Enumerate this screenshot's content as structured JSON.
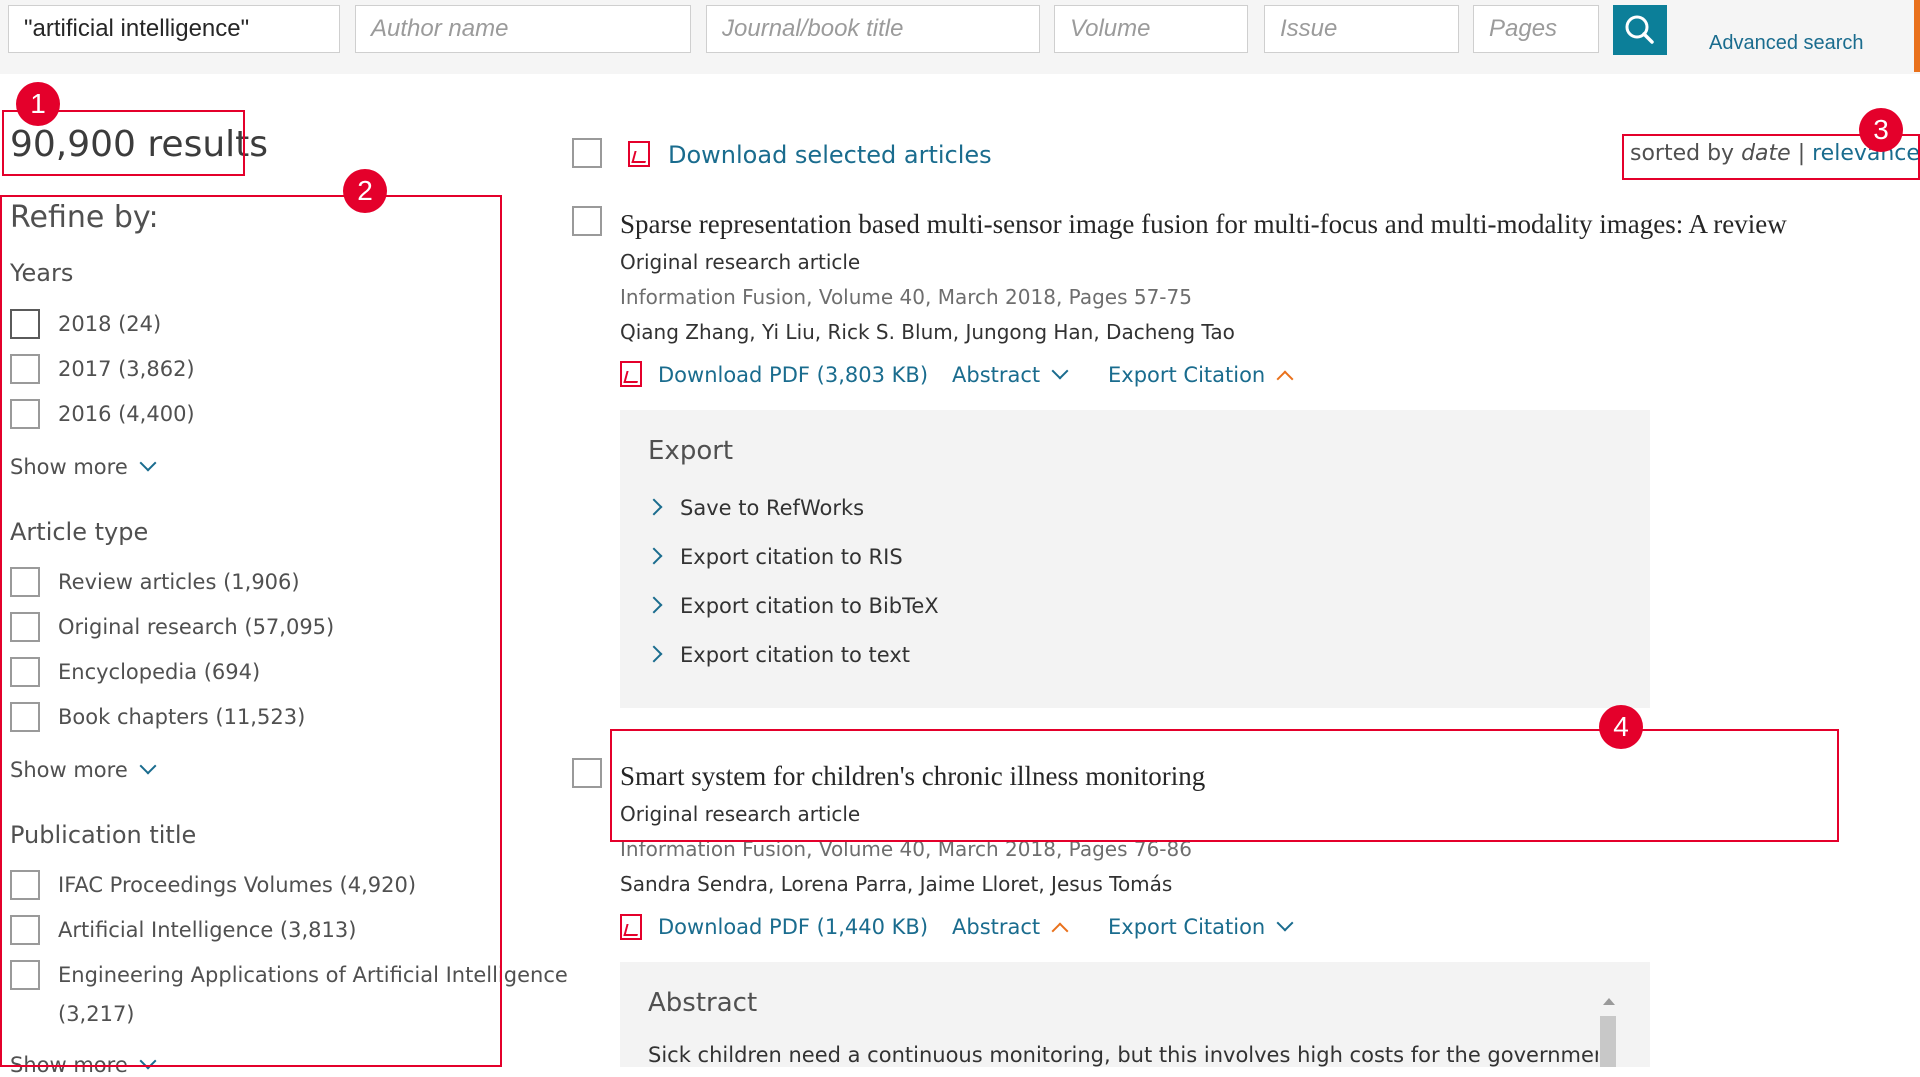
{
  "search": {
    "keywords_value": "\"artificial intelligence\"",
    "author_placeholder": "Author name",
    "journal_placeholder": "Journal/book title",
    "volume_placeholder": "Volume",
    "issue_placeholder": "Issue",
    "pages_placeholder": "Pages",
    "advanced_label": "Advanced search"
  },
  "annotations": [
    "1",
    "2",
    "3",
    "4"
  ],
  "results_count": "90,900 results",
  "sidebar": {
    "heading": "Refine by:",
    "years": {
      "title": "Years",
      "items": [
        "2018 (24)",
        "2017 (3,862)",
        "2016 (4,400)"
      ],
      "show_more": "Show more"
    },
    "article_type": {
      "title": "Article type",
      "items": [
        "Review articles (1,906)",
        "Original research (57,095)",
        "Encyclopedia (694)",
        "Book chapters (11,523)"
      ],
      "show_more": "Show more"
    },
    "publication": {
      "title": "Publication title",
      "items": [
        "IFAC Proceedings Volumes (4,920)",
        "Artificial Intelligence (3,813)",
        "Engineering Applications of Artificial Intelligence",
        "(3,217)"
      ],
      "show_more": "Show more"
    }
  },
  "toolbar": {
    "download_selected": "Download selected articles",
    "sorted_by": "sorted by",
    "sort_date": "date",
    "separator": "|",
    "sort_relevance": "relevance"
  },
  "results": [
    {
      "title": "Sparse representation based multi-sensor image fusion for multi-focus and multi-modality images: A review",
      "type": "Original research article",
      "source": "Information Fusion, Volume 40, March 2018, Pages 57-75",
      "authors": "Qiang Zhang, Yi Liu, Rick S. Blum, Jungong Han, Dacheng Tao",
      "download_pdf": "Download PDF (3,803 KB)",
      "abstract_label": "Abstract",
      "export_label": "Export Citation"
    },
    {
      "title": "Smart system for children's chronic illness monitoring",
      "type": "Original research article",
      "source": "Information Fusion, Volume 40, March 2018, Pages 76-86",
      "authors": "Sandra Sendra, Lorena Parra, Jaime Lloret, Jesus Tomás",
      "download_pdf": "Download PDF (1,440 KB)",
      "abstract_label": "Abstract",
      "export_label": "Export Citation"
    }
  ],
  "export_panel": {
    "heading": "Export",
    "items": [
      "Save to RefWorks",
      "Export citation to RIS",
      "Export citation to BibTeX",
      "Export citation to text"
    ]
  },
  "abstract_panel": {
    "heading": "Abstract",
    "text": "Sick children need a continuous monitoring, but this involves high costs for the government"
  },
  "icons": {
    "search": "search-icon",
    "pdf": "pdf-icon",
    "chevron_down": "chevron-down-icon",
    "chevron_up": "chevron-up-icon",
    "chevron_right": "chevron-right-icon"
  },
  "colors": {
    "link": "#1a6c8e",
    "search_button": "#0c7f99",
    "annotation_red": "#e4002b",
    "accent_orange": "#e9711c",
    "panel_bg": "#f3f3f3"
  }
}
